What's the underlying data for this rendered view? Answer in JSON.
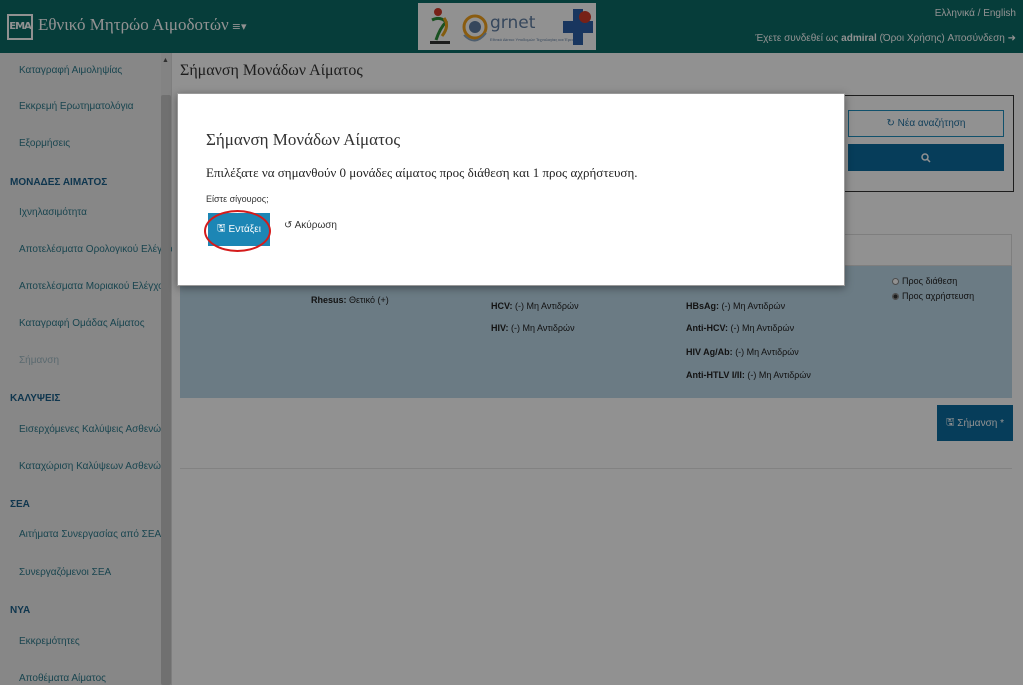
{
  "header": {
    "logo_text": "EMA",
    "brand_title": "Εθνικό Μητρώο Αιμοδοτών",
    "menu_icon": "≡▾",
    "partner_grnet": "grnet",
    "partner_grnet_sub": "Εθνικό Δίκτυο Υποδομών Τεχνολογίας και Έρευνας",
    "lang": "Ελληνικά / English",
    "session_prefix": "Έχετε συνδεθεί ως",
    "session_user": "admiral",
    "session_terms": "(Όροι Χρήσης)",
    "session_logout": "Αποσύνδεση"
  },
  "sidebar": {
    "items": [
      {
        "label": "Καταγραφή Αιμοληψίας"
      },
      {
        "label": "Εκκρεμή Ερωτηματολόγια"
      },
      {
        "label": "Εξορμήσεις"
      }
    ],
    "sections": [
      {
        "title": "ΜΟΝΑΔΕΣ ΑΙΜΑΤΟΣ",
        "items": [
          "Ιχνηλασιμότητα",
          "Αποτελέσματα Ορολογικού Ελέγχου",
          "Αποτελέσματα Μοριακού Ελέγχου",
          "Καταγραφή Ομάδας Αίματος",
          "Σήμανση"
        ]
      },
      {
        "title": "ΚΑΛΥΨΕΙΣ",
        "items": [
          "Εισερχόμενες Καλύψεις Ασθενών",
          "Καταχώριση Καλύψεων Ασθενών"
        ]
      },
      {
        "title": "ΣΕΑ",
        "items": [
          "Αιτήματα Συνεργασίας από ΣΕΑ",
          "Συνεργαζόμενοι ΣΕΑ"
        ]
      },
      {
        "title": "ΝΥΑ",
        "items": [
          "Εκκρεμότητες",
          "Αποθέματα Αίματος"
        ]
      }
    ]
  },
  "main": {
    "page_title": "Σήμανση Μονάδων Αίματος",
    "new_search_label": "Νέα αναζήτηση",
    "search_icon": "search-icon",
    "result": {
      "rhesus_label": "Rhesus:",
      "rhesus_value": "Θετικό (+)",
      "hcv_label": "HCV:",
      "hcv_value": "(-) Μη Αντιδρών",
      "hiv_label": "HIV:",
      "hiv_value": "(-) Μη Αντιδρών",
      "hbsag_label": "HBsAg:",
      "hbsag_value": "(-) Μη Αντιδρών",
      "antihcv_label": "Anti-HCV:",
      "antihcv_value": "(-) Μη Αντιδρών",
      "hivagab_label": "HIV Ag/Ab:",
      "hivagab_value": "(-) Μη Αντιδρών",
      "antihtlv_label": "Anti-HTLV I/II:",
      "antihtlv_value": "(-) Μη Αντιδρών",
      "option_availability": "Προς διάθεση",
      "option_disposal": "Προς αχρήστευση"
    },
    "mark_button": "Σήμανση *"
  },
  "modal": {
    "title": "Σήμανση Μονάδων Αίματος",
    "body": "Επιλέξατε να σημανθούν 0 μονάδες αίματος προς διάθεση και 1 προς αχρήστευση.",
    "confirm": "Είστε σίγουρος;",
    "ok_label": "Εντάξει",
    "cancel_label": "Ακύρωση"
  },
  "colors": {
    "header": "#0b6b66",
    "primary_button": "#0b6b9e",
    "ok_button": "#1c86b5",
    "result_row": "#bcd8e9",
    "annotation_ring": "#d41b1b"
  }
}
